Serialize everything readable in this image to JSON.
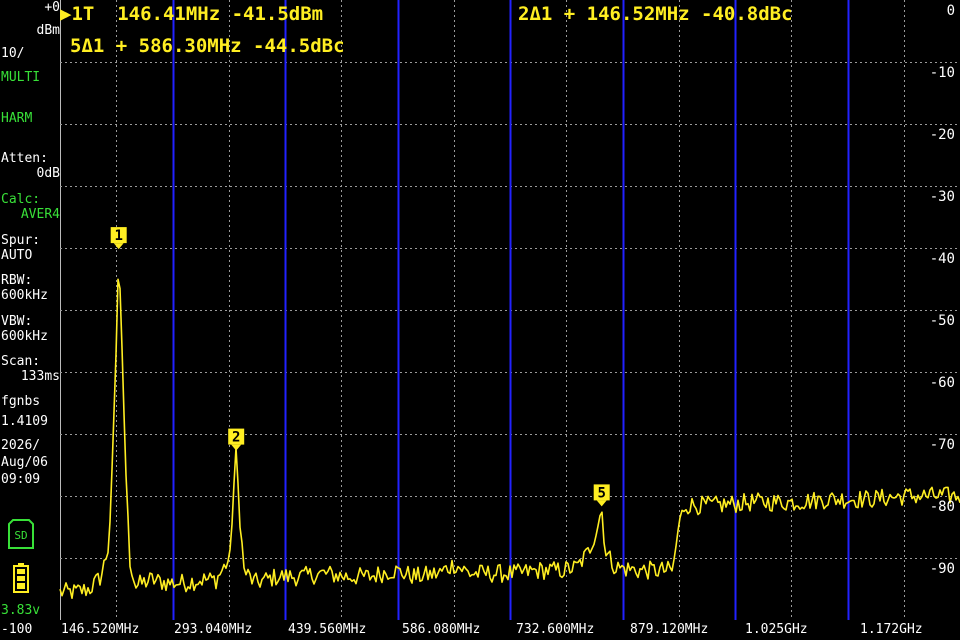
{
  "sidebar": {
    "ref_level": "+0",
    "ref_unit": "dBm",
    "scale_div": "10/",
    "mode1": "MULTI",
    "mode2": "HARM",
    "atten_label": "Atten:",
    "atten_value": "0dB",
    "calc_label": "Calc:",
    "calc_value": "AVER4",
    "spur_label": "Spur:",
    "spur_value": "AUTO",
    "rbw_label": "RBW:",
    "rbw_value": "600kHz",
    "vbw_label": "VBW:",
    "vbw_value": "600kHz",
    "scan_label": "Scan:",
    "scan_value": "133ms",
    "fw_label": "fgnbs",
    "fw_value": "1.4109",
    "date_year": "2026/",
    "date_md": "Aug/06",
    "time": "09:09",
    "sd_icon_label": "SD",
    "battery_voltage": "3.83v",
    "bottom_level": "-100"
  },
  "markers": {
    "m1_readout": "▶1T  146.41MHz -41.5dBm",
    "m5_readout": "5Δ1 + 586.30MHz -44.5dBc",
    "m2_readout": "2Δ1 + 146.52MHz -40.8dBc"
  },
  "scale_labels": [
    "0",
    "-10",
    "-20",
    "-30",
    "-40",
    "-50",
    "-60",
    "-70",
    "-80",
    "-90"
  ],
  "freq_labels": [
    "146.520MHz",
    "293.040MHz",
    "439.560MHz",
    "586.080MHz",
    "732.600MHz",
    "879.120MHz",
    "1.025GHz",
    "1.172GHz"
  ],
  "chart_data": {
    "type": "line",
    "title": "",
    "xlabel": "",
    "ylabel": "",
    "ylim": [
      -100,
      0
    ],
    "grid": true,
    "trace_color": "#ffee22",
    "harmonic_line_color": "#2222ff",
    "x_unit": "MHz",
    "y_unit": "dBm",
    "x_range": [
      146.52,
      1318.68
    ],
    "harmonic_lines_mhz": [
      293.04,
      439.56,
      586.08,
      732.6,
      879.12,
      1025.64,
      1172.16
    ],
    "series": [
      {
        "points": [
          [
            146.52,
            -95.5
          ],
          [
            165,
            -95.5
          ],
          [
            185,
            -95
          ],
          [
            200,
            -93
          ],
          [
            210,
            -88
          ],
          [
            215,
            -75
          ],
          [
            220,
            -55
          ],
          [
            223,
            -40.5
          ],
          [
            227,
            -55
          ],
          [
            232,
            -75
          ],
          [
            237,
            -90
          ],
          [
            245,
            -94.5
          ],
          [
            265,
            -93.5
          ],
          [
            285,
            -94
          ],
          [
            310,
            -94
          ],
          [
            330,
            -93.5
          ],
          [
            350,
            -93.5
          ],
          [
            368,
            -90
          ],
          [
            372,
            -80
          ],
          [
            376,
            -73
          ],
          [
            380,
            -82
          ],
          [
            386,
            -92
          ],
          [
            400,
            -94
          ],
          [
            430,
            -93
          ],
          [
            460,
            -93
          ],
          [
            490,
            -92.5
          ],
          [
            520,
            -93
          ],
          [
            550,
            -93
          ],
          [
            580,
            -92
          ],
          [
            610,
            -93
          ],
          [
            640,
            -92.5
          ],
          [
            660,
            -91
          ],
          [
            680,
            -92.5
          ],
          [
            710,
            -92.5
          ],
          [
            740,
            -92.5
          ],
          [
            770,
            -92
          ],
          [
            800,
            -92
          ],
          [
            820,
            -91.5
          ],
          [
            835,
            -89
          ],
          [
            845,
            -85.5
          ],
          [
            852,
            -82
          ],
          [
            857,
            -89
          ],
          [
            870,
            -91.5
          ],
          [
            900,
            -92
          ],
          [
            930,
            -92
          ],
          [
            945,
            -92
          ],
          [
            952,
            -85
          ],
          [
            960,
            -81.5
          ],
          [
            1000,
            -81.5
          ],
          [
            1050,
            -81
          ],
          [
            1100,
            -81
          ],
          [
            1150,
            -80.5
          ],
          [
            1200,
            -80.5
          ],
          [
            1250,
            -80
          ],
          [
            1290,
            -80
          ],
          [
            1318.68,
            -80
          ]
        ]
      }
    ],
    "markers": [
      {
        "label": "1",
        "x": 223,
        "y": -40.5
      },
      {
        "label": "2",
        "x": 376,
        "y": -73
      },
      {
        "label": "5",
        "x": 852,
        "y": -82
      }
    ]
  }
}
